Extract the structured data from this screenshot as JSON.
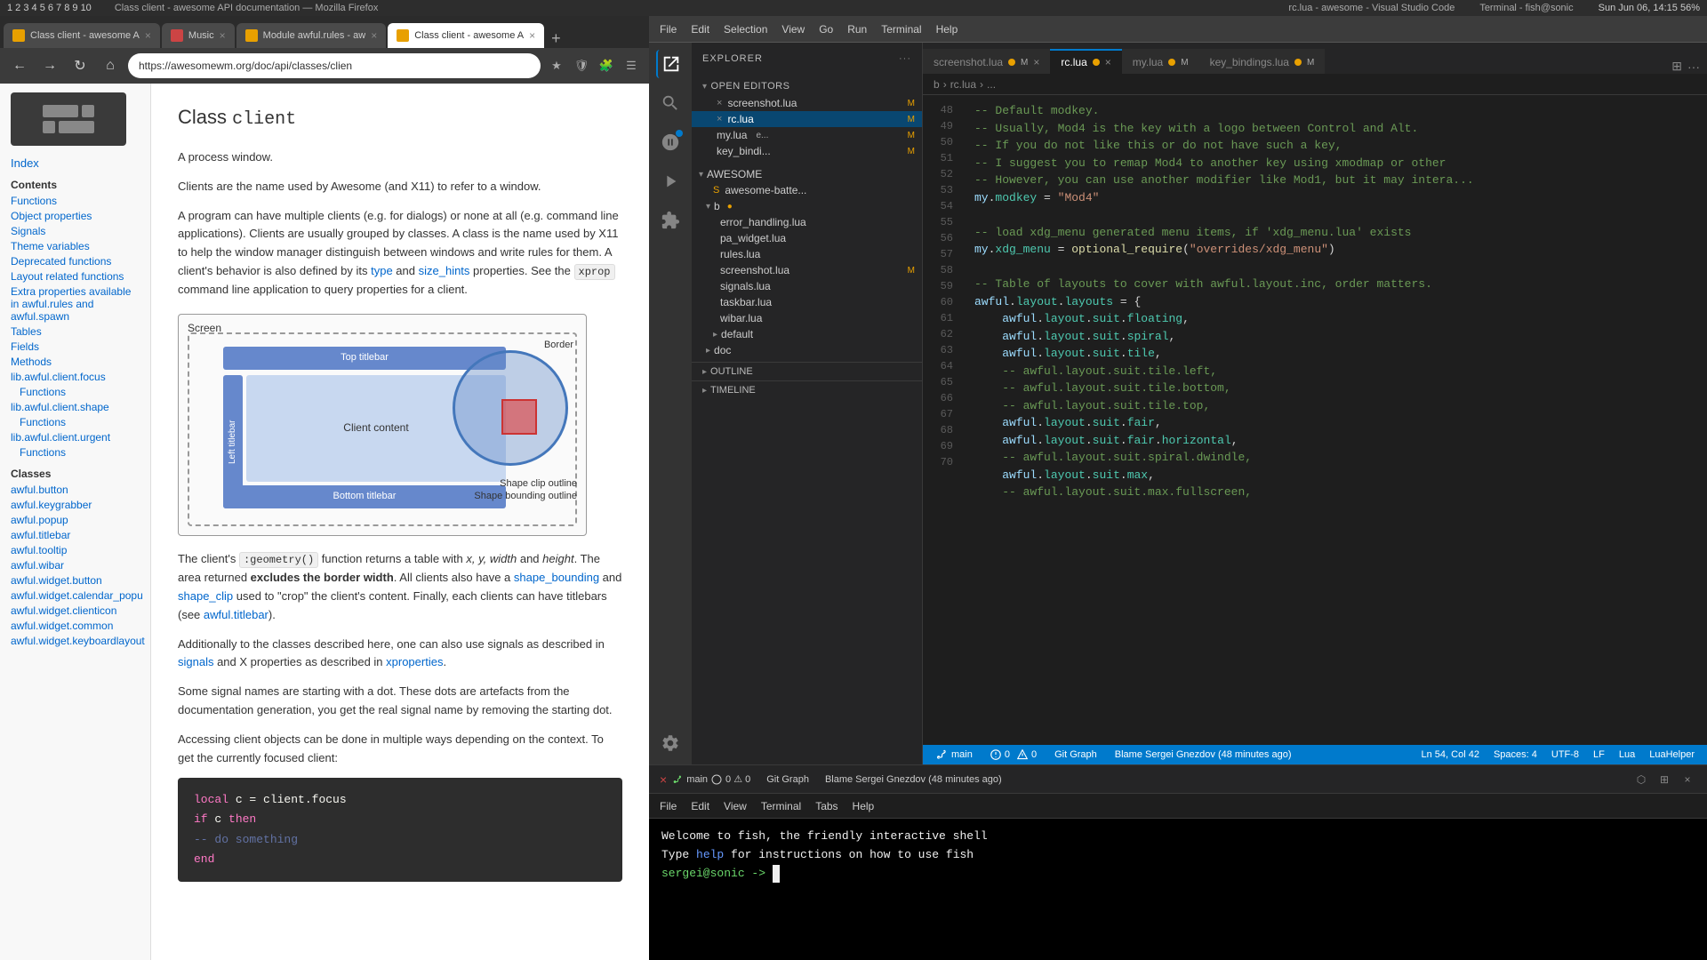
{
  "os_bar": {
    "left_items": [
      "1",
      "2",
      "3",
      "4",
      "5",
      "6",
      "7",
      "8",
      "9",
      "10"
    ],
    "browser_title": "Class client - awesome API documentation — Mozilla Firefox",
    "vscode_title": "rc.lua - awesome - Visual Studio Code",
    "terminal_title": "Terminal - fish@sonic",
    "datetime": "Sun Jun 06, 14:15  56%"
  },
  "browser": {
    "tabs": [
      {
        "id": "tab1",
        "label": "Class client - awesome A",
        "active": false,
        "favicon_color": "#e8a000"
      },
      {
        "id": "tab2",
        "label": "Music",
        "active": false,
        "favicon_color": "#cc4444"
      },
      {
        "id": "tab3",
        "label": "Module awful.rules - aw",
        "active": false,
        "favicon_color": "#e8a000"
      },
      {
        "id": "tab4",
        "label": "Class client - awesome A",
        "active": true,
        "favicon_color": "#e8a000"
      }
    ],
    "url": "https://awesomewm.org/doc/api/classes/clien",
    "doc": {
      "title_prefix": "Class ",
      "title_code": "client",
      "subtitle": "A process window.",
      "p1": "Clients are the name used by Awesome (and X11) to refer to a window.",
      "p2": "A program can have multiple clients (e.g. for dialogs) or none at all (e.g. command line applications). Clients are usually grouped by classes. A class is the name used by X11 to help the window manager distinguish between windows and write rules for them. A client's behavior is also defined by its type and size_hints properties. See the xprop command line application to query properties for a client.",
      "diagram": {
        "screen_label": "Screen",
        "top_titlebar": "Top titlebar",
        "left_titlebar": "Left titlebar",
        "bottom_titlebar": "Bottom titlebar",
        "client_content": "Client content",
        "border_label": "Border",
        "shape_clip": "Shape clip outline",
        "shape_bound": "Shape bounding outline"
      },
      "p3_prefix": "The client's ",
      "p3_code": ":geometry()",
      "p3_mid": " function returns a table with ",
      "p3_italic": "x, y, width",
      "p3_and": " and ",
      "p3_height": "height",
      "p3_suffix": ". The area returned ",
      "p3_bold": "excludes the border width",
      "p3_rest": ". All clients also have a shape_bounding and shape_clip used to \"crop\" the client's content. Finally, each clients can have titlebars (see awful.titlebar).",
      "p4": "Additionally to the classes described here, one can also use signals as described in signals and X properties as described in xproperties.",
      "p5": "Some signal names are starting with a dot. These dots are artefacts from the documentation generation, you get the real signal name by removing the starting dot.",
      "p6": "Accessing client objects can be done in multiple ways depending on the context. To get the currently focused client:",
      "code_block": {
        "line1": "local c = client.focus",
        "line2": "if c then",
        "line3": "    -- do something",
        "line4": "end"
      }
    },
    "sidebar": {
      "index_label": "Index",
      "contents_title": "Contents",
      "contents_links": [
        "Functions",
        "Object properties",
        "Signals",
        "Theme variables",
        "Deprecated functions",
        "Layout related functions",
        "Extra properties available in awful.rules and awful.spawn",
        "Tables",
        "Fields",
        "Methods"
      ],
      "lib_links": [
        {
          "label": "lib.awful.client.focus",
          "sub": "Functions"
        },
        {
          "label": "lib.awful.client.shape",
          "sub": "Functions"
        },
        {
          "label": "lib.awful.client.urgent",
          "sub": "Functions"
        }
      ],
      "classes_title": "Classes",
      "classes_links": [
        "awful.button",
        "awful.keygrabber",
        "awful.popup",
        "awful.titlebar",
        "awful.tooltip",
        "awful.wibar",
        "awful.widget.button",
        "awful.widget.calendar_popu",
        "awful.widget.clienticon",
        "awful.widget.common",
        "awful.widget.keyboardlayout"
      ]
    }
  },
  "vscode": {
    "menu_items": [
      "File",
      "Edit",
      "Selection",
      "View",
      "Go",
      "Run",
      "Terminal",
      "Help"
    ],
    "tabs": [
      {
        "id": "screenshot",
        "label": "screenshot.lua",
        "modified": true,
        "active": false,
        "close": "×"
      },
      {
        "id": "rc",
        "label": "rc.lua",
        "modified": true,
        "active": true,
        "close": "×"
      },
      {
        "id": "my",
        "label": "my.lua",
        "modified": true,
        "active": false,
        "close": ""
      },
      {
        "id": "key_bindings",
        "label": "key_bindings.lua",
        "modified": true,
        "active": false,
        "close": ""
      }
    ],
    "breadcrumb": "rc.lua > ...",
    "explorer": {
      "title": "Explorer",
      "open_editors": "Open Editors",
      "files": [
        {
          "name": "screenshot.lua",
          "modified": "M"
        },
        {
          "name": "rc.lua",
          "modified": "M",
          "active": true
        },
        {
          "name": "my.lua",
          "modified": "M"
        },
        {
          "name": "key_bindi...",
          "modified": "M"
        }
      ],
      "awesome_folder": "AWESOME",
      "awesome_batte": "awesome-batte...",
      "b_folder": "b",
      "sub_files": [
        "error_handling.lua",
        "pa_widget.lua",
        "rules.lua",
        "screenshot.lua",
        "signals.lua",
        "taskbar.lua",
        "wibar.lua",
        "default"
      ],
      "doc_folder": "doc",
      "outline_label": "OUTLINE",
      "timeline_label": "TIMELINE"
    },
    "code_lines": [
      {
        "num": "48",
        "content": "-- Default modkey."
      },
      {
        "num": "49",
        "content": "-- Usually, Mod4 is the key with a logo between Control and Alt."
      },
      {
        "num": "50",
        "content": "-- If you do not like this or do not have such a key,"
      },
      {
        "num": "51",
        "content": "-- I suggest you to remap Mod4 to another key using xmodmap or other"
      },
      {
        "num": "52",
        "content": "-- However, you can use another modifier like Mod1, but it may intera..."
      },
      {
        "num": "53",
        "content": "my.modkey = \"Mod4\""
      },
      {
        "num": "54",
        "content": ""
      },
      {
        "num": "55",
        "content": "-- load xdg_menu generated menu items, if 'xdg_menu.lua' exists"
      },
      {
        "num": "56",
        "content": "my.xdg_menu = optional_require(\"overrides/xdg_menu\")"
      },
      {
        "num": "57",
        "content": ""
      },
      {
        "num": "58",
        "content": "-- Table of layouts to cover with awful.layout.inc, order matters."
      },
      {
        "num": "59",
        "content": "awful.layout.layouts = {"
      },
      {
        "num": "60",
        "content": "    awful.layout.suit.floating,"
      },
      {
        "num": "61",
        "content": "    awful.layout.suit.spiral,"
      },
      {
        "num": "62",
        "content": "    awful.layout.suit.tile,"
      },
      {
        "num": "63",
        "content": "    -- awful.layout.suit.tile.left,"
      },
      {
        "num": "64",
        "content": "    -- awful.layout.suit.tile.bottom,"
      },
      {
        "num": "65",
        "content": "    -- awful.layout.suit.tile.top,"
      },
      {
        "num": "66",
        "content": "    awful.layout.suit.fair,"
      },
      {
        "num": "67",
        "content": "    awful.layout.suit.fair.horizontal,"
      },
      {
        "num": "68",
        "content": "    -- awful.layout.suit.spiral.dwindle,"
      },
      {
        "num": "69",
        "content": "    awful.layout.suit.max,"
      },
      {
        "num": "70",
        "content": "    -- awful.layout.suit.max.fullscreen,"
      }
    ],
    "statusbar": {
      "branch": "main",
      "errors": "0",
      "warnings": "0",
      "git_graph": "Git Graph",
      "blame": "Blame Sergei Gnezdov (48 minutes ago)",
      "cursor": "Ln 54, Col 42",
      "spaces": "Spaces: 4",
      "encoding": "UTF-8",
      "line_ending": "LF",
      "language": "Lua",
      "lua_helper": "LuaHelper"
    }
  },
  "terminal": {
    "menu_items": [
      "File",
      "Edit",
      "View",
      "Terminal",
      "Tabs",
      "Help"
    ],
    "welcome": "Welcome to fish, the friendly interactive shell",
    "help_text": "Type ",
    "help_link": "help",
    "help_suffix": " for instructions on how to use fish",
    "prompt": "sergei@sonic -> "
  }
}
